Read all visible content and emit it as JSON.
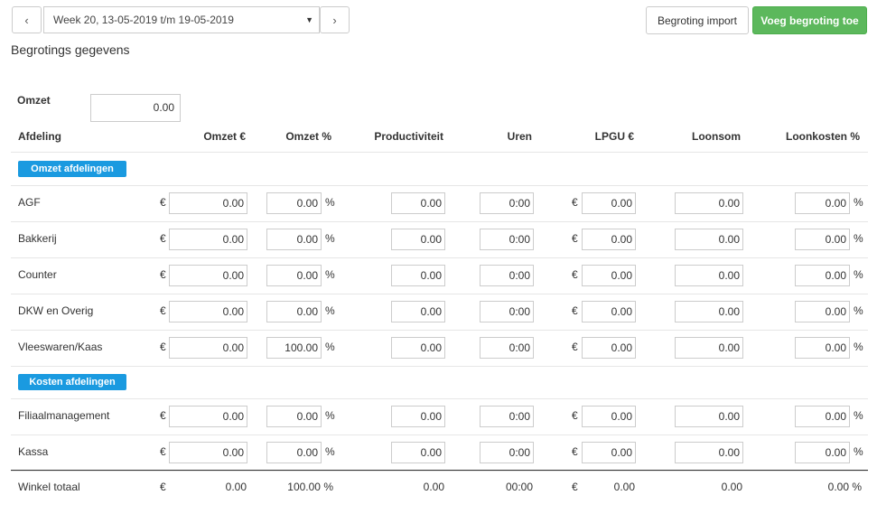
{
  "toolbar": {
    "prev_icon": "‹",
    "next_icon": "›",
    "week_value": "Week 20, 13-05-2019 t/m 19-05-2019",
    "import_label": "Begroting import",
    "add_label": "Voeg begroting toe"
  },
  "page_title": "Begrotings gegevens",
  "omzet": {
    "label": "Omzet",
    "value": "0.00"
  },
  "columns": {
    "afdeling": "Afdeling",
    "omzet_eur": "Omzet €",
    "omzet_pct": "Omzet %",
    "productiviteit": "Productiviteit",
    "uren": "Uren",
    "lpgu": "LPGU €",
    "loonsom": "Loonsom",
    "loonkosten": "Loonkosten %"
  },
  "units": {
    "euro": "€",
    "pct": "%"
  },
  "groups": [
    {
      "label": "Omzet afdelingen",
      "rows": [
        {
          "name": "AGF",
          "omzet": "0.00",
          "omzet_pct": "0.00",
          "productiviteit": "0.00",
          "uren": "0:00",
          "lpgu": "0.00",
          "loonsom": "0.00",
          "loonkosten": "0.00"
        },
        {
          "name": "Bakkerij",
          "omzet": "0.00",
          "omzet_pct": "0.00",
          "productiviteit": "0.00",
          "uren": "0:00",
          "lpgu": "0.00",
          "loonsom": "0.00",
          "loonkosten": "0.00"
        },
        {
          "name": "Counter",
          "omzet": "0.00",
          "omzet_pct": "0.00",
          "productiviteit": "0.00",
          "uren": "0:00",
          "lpgu": "0.00",
          "loonsom": "0.00",
          "loonkosten": "0.00"
        },
        {
          "name": "DKW en Overig",
          "omzet": "0.00",
          "omzet_pct": "0.00",
          "productiviteit": "0.00",
          "uren": "0:00",
          "lpgu": "0.00",
          "loonsom": "0.00",
          "loonkosten": "0.00"
        },
        {
          "name": "Vleeswaren/Kaas",
          "omzet": "0.00",
          "omzet_pct": "100.00",
          "productiviteit": "0.00",
          "uren": "0:00",
          "lpgu": "0.00",
          "loonsom": "0.00",
          "loonkosten": "0.00"
        }
      ]
    },
    {
      "label": "Kosten afdelingen",
      "rows": [
        {
          "name": "Filiaalmanagement",
          "omzet": "0.00",
          "omzet_pct": "0.00",
          "productiviteit": "0.00",
          "uren": "0:00",
          "lpgu": "0.00",
          "loonsom": "0.00",
          "loonkosten": "0.00"
        },
        {
          "name": "Kassa",
          "omzet": "0.00",
          "omzet_pct": "0.00",
          "productiviteit": "0.00",
          "uren": "0:00",
          "lpgu": "0.00",
          "loonsom": "0.00",
          "loonkosten": "0.00"
        }
      ]
    }
  ],
  "totals": {
    "label": "Winkel totaal",
    "omzet": "0.00",
    "omzet_pct": "100.00 %",
    "productiviteit": "0.00",
    "uren": "00:00",
    "lpgu": "0.00",
    "loonsom": "0.00",
    "loonkosten": "0.00 %"
  }
}
